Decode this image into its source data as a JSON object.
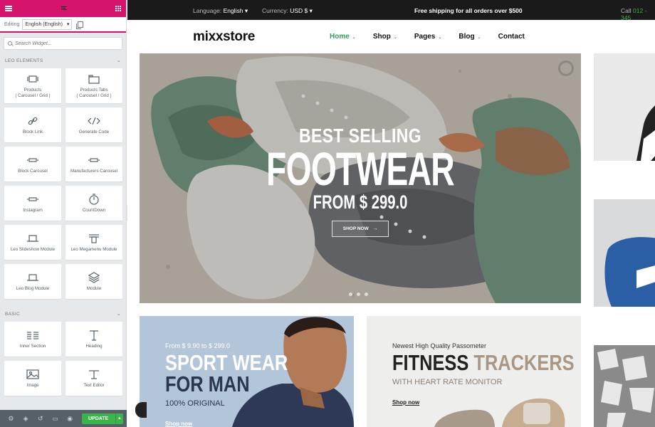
{
  "editor": {
    "editing_label": "Editing",
    "language_select": "English (English)",
    "search_placeholder": "Search Widget...",
    "sections": [
      {
        "title": "LEO ELEMENTS",
        "widgets": [
          {
            "label1": "Products",
            "label2": "( Carousel / Grid )",
            "icon": "product-carousel-icon"
          },
          {
            "label1": "Products Tabs",
            "label2": "( Carousel / Grid )",
            "icon": "product-tabs-icon"
          },
          {
            "label1": "Block Link",
            "label2": "",
            "icon": "link-icon"
          },
          {
            "label1": "Generate Code",
            "label2": "",
            "icon": "code-icon"
          },
          {
            "label1": "Block Carousel",
            "label2": "",
            "icon": "block-carousel-icon"
          },
          {
            "label1": "Manufacturers Carousel",
            "label2": "",
            "icon": "manufacturers-carousel-icon"
          },
          {
            "label1": "Instagram",
            "label2": "",
            "icon": "instagram-icon"
          },
          {
            "label1": "CountDown",
            "label2": "",
            "icon": "stopwatch-icon"
          },
          {
            "label1": "Leo Slideshow Module",
            "label2": "",
            "icon": "slideshow-icon"
          },
          {
            "label1": "Leo Megamenu Module",
            "label2": "",
            "icon": "megamenu-icon"
          },
          {
            "label1": "Leo Blog Module",
            "label2": "",
            "icon": "blog-icon"
          },
          {
            "label1": "Module",
            "label2": "",
            "icon": "cube-icon"
          }
        ]
      },
      {
        "title": "BASIC",
        "widgets": [
          {
            "label1": "Inner Section",
            "label2": "",
            "icon": "columns-icon"
          },
          {
            "label1": "Heading",
            "label2": "",
            "icon": "heading-icon"
          },
          {
            "label1": "Image",
            "label2": "",
            "icon": "image-icon"
          },
          {
            "label1": "Text Editor",
            "label2": "",
            "icon": "text-editor-icon"
          }
        ]
      }
    ],
    "footer": {
      "update_label": "UPDATE",
      "icons": [
        "settings-icon",
        "layers-icon",
        "history-icon",
        "responsive-icon",
        "preview-eye-icon"
      ]
    },
    "colors": {
      "accent": "#d5136c",
      "update": "#39b54a"
    }
  },
  "store": {
    "topbar": {
      "language_label": "Language:",
      "language_value": "English",
      "currency_label": "Currency:",
      "currency_value": "USD $",
      "promo": "Free shipping for all orders over $500",
      "call_label": "Call",
      "call_value": "012 - 345"
    },
    "logo": "mixxstore",
    "nav": [
      "Home",
      "Shop",
      "Pages",
      "Blog",
      "Contact"
    ],
    "hero": {
      "line1": "BEST SELLING",
      "line2": "FOOTWEAR",
      "line3": "FROM $ 299.0",
      "button": "SHOP NOW",
      "slide_count": 3
    },
    "banner_sport": {
      "small": "From $ 9.90 to $ 299.0",
      "title1": "SPORT WEAR",
      "title2": "FOR MAN",
      "sub": "100% ORIGINAL",
      "link": "Shop now"
    },
    "banner_fitness": {
      "small": "Newest High Quality Passometer",
      "title_dark": "FITNESS",
      "title_light": "TRACKERS",
      "sub": "WITH HEART RATE MONITOR",
      "link": "Shop now"
    },
    "colors": {
      "nav_active": "#2f9e5c",
      "topbar_bg": "#1a1a1a"
    }
  }
}
